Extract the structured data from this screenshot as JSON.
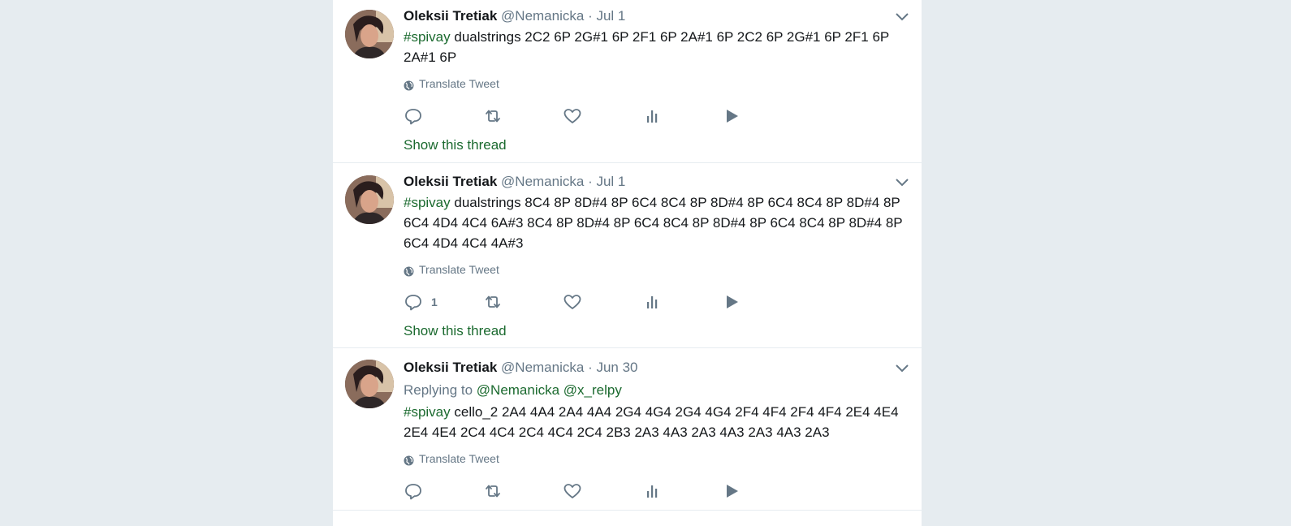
{
  "tweets": [
    {
      "name": "Oleksii Tretiak",
      "handle": "@Nemanicka",
      "dot": "·",
      "time": "Jul 1",
      "reply_label": "",
      "reply_mentions": "",
      "hashtag": "#spivay",
      "body": " dualstrings 2C2 6P 2G#1 6P 2F1 6P 2A#1 6P 2C2 6P 2G#1 6P 2F1 6P 2A#1 6P",
      "translate": "Translate Tweet",
      "reply_count": "",
      "show_thread": "Show this thread"
    },
    {
      "name": "Oleksii Tretiak",
      "handle": "@Nemanicka",
      "dot": "·",
      "time": "Jul 1",
      "reply_label": "",
      "reply_mentions": "",
      "hashtag": "#spivay",
      "body": " dualstrings 8C4 8P 8D#4 8P 6C4 8C4 8P 8D#4 8P 6C4 8C4 8P 8D#4 8P 6C4 4D4 4C4 6A#3 8C4 8P 8D#4 8P 6C4 8C4 8P 8D#4 8P 6C4 8C4 8P 8D#4 8P 6C4 4D4 4C4 4A#3",
      "translate": "Translate Tweet",
      "reply_count": "1",
      "show_thread": "Show this thread"
    },
    {
      "name": "Oleksii Tretiak",
      "handle": "@Nemanicka",
      "dot": "·",
      "time": "Jun 30",
      "reply_label": "Replying to ",
      "reply_mentions": "@Nemanicka @x_relpy",
      "hashtag": "#spivay",
      "body": " cello_2 2A4 4A4 2A4 4A4 2G4 4G4 2G4 4G4 2F4 4F4 2F4 4F4 2E4 4E4 2E4 4E4 2C4 4C4 2C4 4C4 2C4 2B3 2A3 4A3 2A3 4A3 2A3 4A3 2A3",
      "translate": "Translate Tweet",
      "reply_count": "",
      "show_thread": ""
    }
  ],
  "colors": {
    "background": "#e6ecf0",
    "link_green": "#1b6a2f",
    "secondary": "#657786"
  },
  "icons": [
    "chevron-down-icon",
    "globe-icon",
    "reply-icon",
    "retweet-icon",
    "like-icon",
    "analytics-icon",
    "play-icon"
  ]
}
